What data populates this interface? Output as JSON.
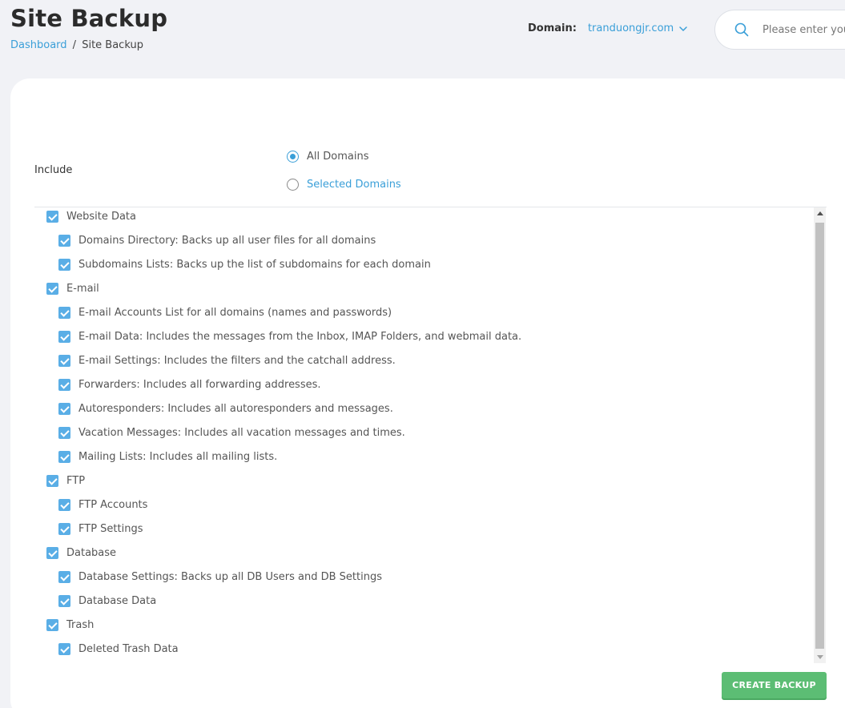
{
  "header": {
    "title": "Site Backup",
    "breadcrumb": {
      "link": "Dashboard",
      "separator": "/",
      "current": "Site Backup"
    },
    "domain_label": "Domain:",
    "domain_value": "tranduongjr.com",
    "search_placeholder": "Please enter your search"
  },
  "form": {
    "include_label": "Include",
    "radio_options": [
      {
        "label": "All Domains",
        "selected": true
      },
      {
        "label": "Selected Domains",
        "selected": false
      }
    ],
    "items": [
      {
        "label": "Website Data",
        "level": 0,
        "checked": true
      },
      {
        "label": "Domains Directory: Backs up all user files for all domains",
        "level": 1,
        "checked": true
      },
      {
        "label": "Subdomains Lists: Backs up the list of subdomains for each domain",
        "level": 1,
        "checked": true
      },
      {
        "label": "E-mail",
        "level": 0,
        "checked": true
      },
      {
        "label": "E-mail Accounts List for all domains (names and passwords)",
        "level": 1,
        "checked": true
      },
      {
        "label": "E-mail Data: Includes the messages from the Inbox, IMAP Folders, and webmail data.",
        "level": 1,
        "checked": true
      },
      {
        "label": "E-mail Settings: Includes the filters and the catchall address.",
        "level": 1,
        "checked": true
      },
      {
        "label": "Forwarders: Includes all forwarding addresses.",
        "level": 1,
        "checked": true
      },
      {
        "label": "Autoresponders: Includes all autoresponders and messages.",
        "level": 1,
        "checked": true
      },
      {
        "label": "Vacation Messages: Includes all vacation messages and times.",
        "level": 1,
        "checked": true
      },
      {
        "label": "Mailing Lists: Includes all mailing lists.",
        "level": 1,
        "checked": true
      },
      {
        "label": "FTP",
        "level": 0,
        "checked": true
      },
      {
        "label": "FTP Accounts",
        "level": 1,
        "checked": true
      },
      {
        "label": "FTP Settings",
        "level": 1,
        "checked": true
      },
      {
        "label": "Database",
        "level": 0,
        "checked": true
      },
      {
        "label": "Database Settings: Backs up all DB Users and DB Settings",
        "level": 1,
        "checked": true
      },
      {
        "label": "Database Data",
        "level": 1,
        "checked": true
      },
      {
        "label": "Trash",
        "level": 0,
        "checked": true
      },
      {
        "label": "Deleted Trash Data",
        "level": 1,
        "checked": true
      }
    ],
    "create_button": "CREATE BACKUP"
  },
  "colors": {
    "accent": "#3a9fd8",
    "checkbox": "#5aaee6",
    "button": "#5cbd74",
    "background": "#f1f2f6"
  },
  "icons": {
    "search": "search-icon",
    "dropdown": "chevron-down-icon",
    "checkbox": "checkmark-icon"
  }
}
